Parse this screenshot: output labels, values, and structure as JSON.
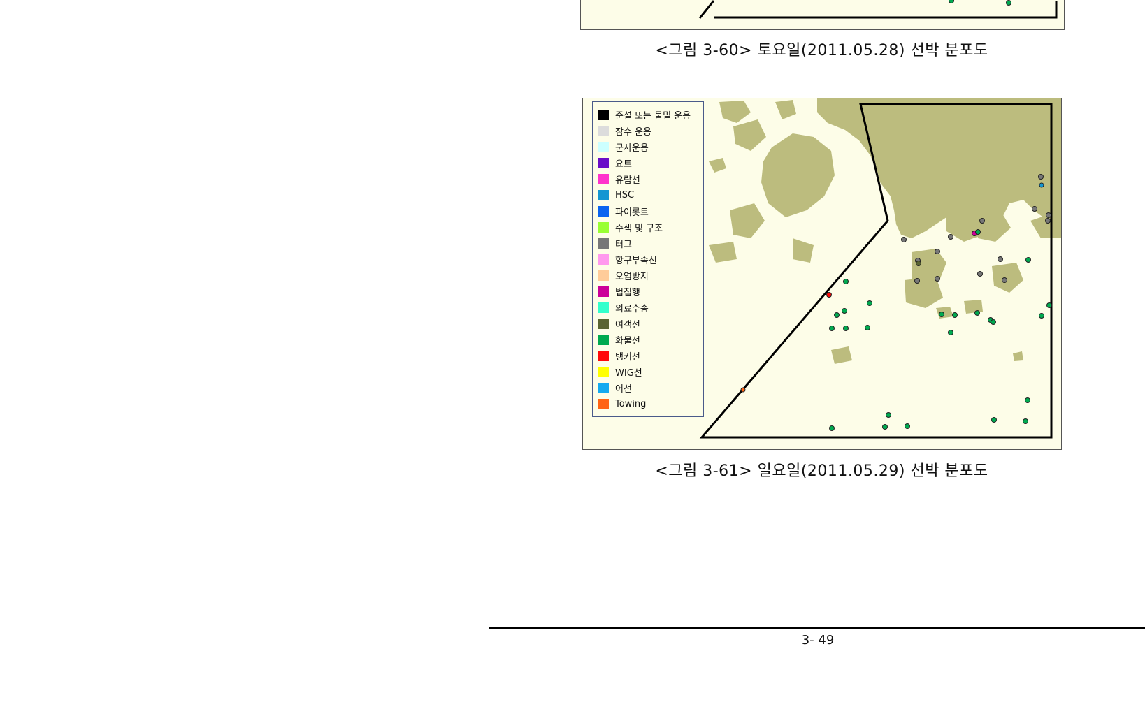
{
  "figures": [
    {
      "caption": "<그림 3-60> 토요일(2011.05.28) 선박 분포도"
    },
    {
      "caption": "<그림 3-61> 일요일(2011.05.29) 선박 분포도",
      "legend": [
        {
          "label": "준설 또는 물밑 운용",
          "color": "#000000"
        },
        {
          "label": "잠수 운용",
          "color": "#dcdcdc"
        },
        {
          "label": "군사운용",
          "color": "#ccffff"
        },
        {
          "label": "요트",
          "color": "#6a0dc8"
        },
        {
          "label": "유람선",
          "color": "#ff33cc"
        },
        {
          "label": "HSC",
          "color": "#1496d2"
        },
        {
          "label": "파이롯트",
          "color": "#0a64f0"
        },
        {
          "label": "수색 및 구조",
          "color": "#99ff33"
        },
        {
          "label": "터그",
          "color": "#777777"
        },
        {
          "label": "항구부속선",
          "color": "#ff99ee"
        },
        {
          "label": "오염방지",
          "color": "#ffcc99"
        },
        {
          "label": "법집행",
          "color": "#cc0099"
        },
        {
          "label": "의료수송",
          "color": "#33ffcc"
        },
        {
          "label": "여객선",
          "color": "#5a6432"
        },
        {
          "label": "화물선",
          "color": "#00aa50"
        },
        {
          "label": "탱커선",
          "color": "#ff0a0a"
        },
        {
          "label": "WIG선",
          "color": "#ffff00"
        },
        {
          "label": "어선",
          "color": "#14aaf0"
        },
        {
          "label": "Towing",
          "color": "#ff6414"
        }
      ]
    }
  ],
  "page_number": "3- 49",
  "colors": {
    "land": "#bcbc7e",
    "sea": "#fdfde8",
    "boundary": "#000000"
  }
}
